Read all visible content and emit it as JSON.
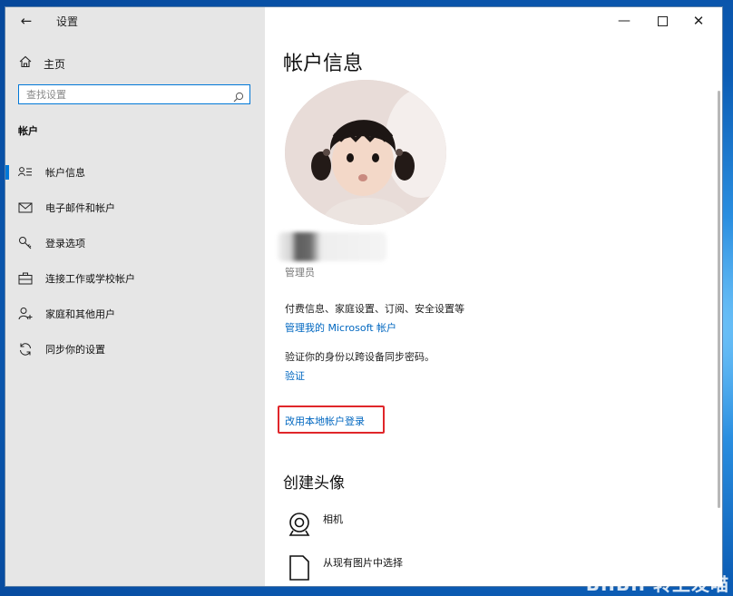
{
  "window": {
    "title": "设置",
    "back_icon": "←",
    "controls": {
      "minimize": "—",
      "maximize": "max-box",
      "close": "✕"
    }
  },
  "sidebar": {
    "home_label": "主页",
    "search_placeholder": "查找设置",
    "section_label": "帐户",
    "items": [
      {
        "label": "帐户信息",
        "icon": "account-info-icon",
        "active": true
      },
      {
        "label": "电子邮件和帐户",
        "icon": "mail-icon"
      },
      {
        "label": "登录选项",
        "icon": "key-icon"
      },
      {
        "label": "连接工作或学校帐户",
        "icon": "briefcase-icon"
      },
      {
        "label": "家庭和其他用户",
        "icon": "add-person-icon"
      },
      {
        "label": "同步你的设置",
        "icon": "sync-icon"
      }
    ]
  },
  "main": {
    "title": "帐户信息",
    "role": "管理员",
    "billing_text": "付费信息、家庭设置、订阅、安全设置等",
    "manage_link": "管理我的 Microsoft 帐户",
    "verify_text": "验证你的身份以跨设备同步密码。",
    "verify_link": "验证",
    "local_signin_link": "改用本地帐户登录",
    "create_avatar_title": "创建头像",
    "options": [
      {
        "label": "相机",
        "icon": "webcam-icon"
      },
      {
        "label": "从现有图片中选择",
        "icon": "image-file-icon"
      }
    ]
  },
  "colors": {
    "accent": "#0078d7",
    "link": "#0067c0",
    "highlight_border": "#e0262a",
    "sidebar_bg": "#e6e6e6"
  },
  "watermark": "BIIBII 转上发喵"
}
